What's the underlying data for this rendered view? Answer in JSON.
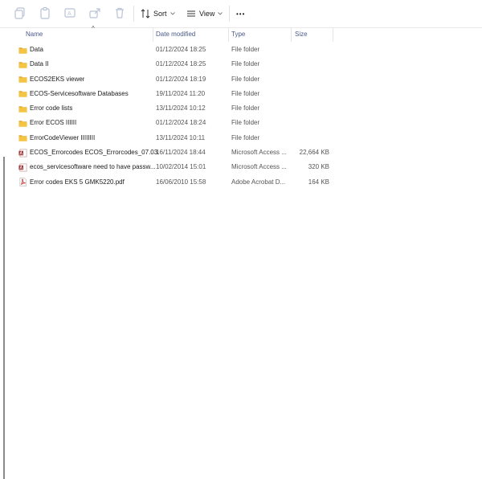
{
  "toolbar": {
    "sort_label": "Sort",
    "view_label": "View",
    "more_label": "•••"
  },
  "columns": {
    "name": "Name",
    "date": "Date modified",
    "type": "Type",
    "size": "Size",
    "sort_indicator": "^"
  },
  "files": [
    {
      "name": "Data",
      "date": "01/12/2024 18:25",
      "type": "File folder",
      "size": "",
      "icon": "folder-icon"
    },
    {
      "name": "Data II",
      "date": "01/12/2024 18:25",
      "type": "File folder",
      "size": "",
      "icon": "folder-icon"
    },
    {
      "name": "ECOS2EKS viewer",
      "date": "01/12/2024 18:19",
      "type": "File folder",
      "size": "",
      "icon": "folder-icon"
    },
    {
      "name": "ECOS-Servicesoftware Databases",
      "date": "19/11/2024 11:20",
      "type": "File folder",
      "size": "",
      "icon": "folder-icon"
    },
    {
      "name": "Error code lists",
      "date": "13/11/2024 10:12",
      "type": "File folder",
      "size": "",
      "icon": "folder-icon"
    },
    {
      "name": "Error ECOS IIIIII",
      "date": "01/12/2024 18:24",
      "type": "File folder",
      "size": "",
      "icon": "folder-icon"
    },
    {
      "name": "ErrorCodeViewer IIIIIIII",
      "date": "13/11/2024 10:11",
      "type": "File folder",
      "size": "",
      "icon": "folder-icon"
    },
    {
      "name": "ECOS_Errorcodes ECOS_Errorcodes_07.03...",
      "date": "16/11/2024 18:44",
      "type": "Microsoft Access ...",
      "size": "22,664 KB",
      "icon": "access-database-icon"
    },
    {
      "name": "ecos_servicesoftware need to have passw...",
      "date": "10/02/2014 15:01",
      "type": "Microsoft Access ...",
      "size": "320 KB",
      "icon": "access-database-icon"
    },
    {
      "name": "Error codes EKS 5 GMK5220.pdf",
      "date": "16/06/2010 15:58",
      "type": "Adobe Acrobat D...",
      "size": "164 KB",
      "icon": "pdf-icon"
    }
  ],
  "colors": {
    "folder": "#f4c542",
    "folder_dark": "#e0a82e",
    "access": "#a4373a",
    "pdf": "#d32f2f",
    "header_text": "#4a5a8a"
  }
}
